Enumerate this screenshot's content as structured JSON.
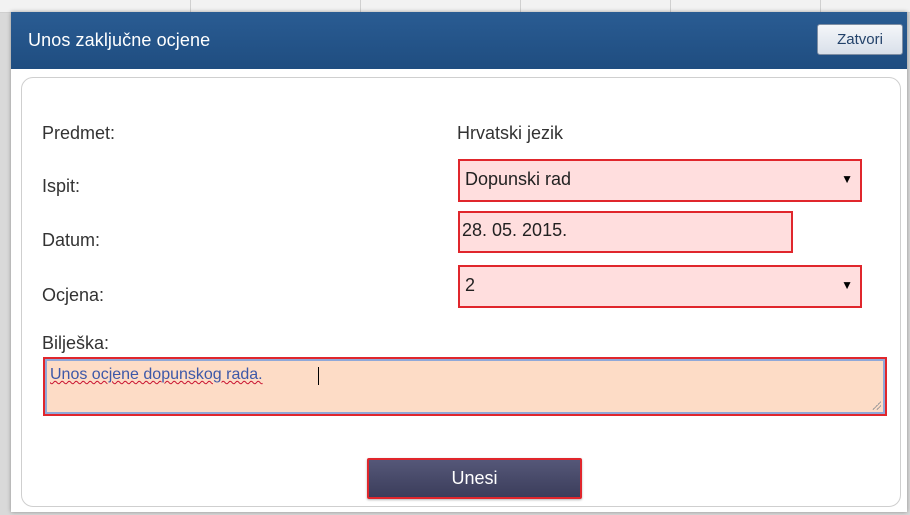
{
  "dialog": {
    "title": "Unos zaključne ocjene",
    "close_label": "Zatvori"
  },
  "form": {
    "subject": {
      "label": "Predmet:",
      "value": "Hrvatski jezik"
    },
    "exam": {
      "label": "Ispit:",
      "selected": "Dopunski rad"
    },
    "date": {
      "label": "Datum:",
      "value": "28. 05. 2015."
    },
    "grade": {
      "label": "Ocjena:",
      "selected": "2"
    },
    "note": {
      "label": "Bilješka:",
      "value": "Unos ocjene dopunskog rada."
    },
    "submit_label": "Unesi"
  },
  "colors": {
    "titlebar": "#235389",
    "required_field_bg": "#ffdede",
    "required_outline": "#e0262c",
    "note_bg": "#fddcc6",
    "submit_bg": "#46486a"
  },
  "icons": {
    "dropdown": "dropdown-arrow-icon",
    "resize": "resize-grip-icon"
  }
}
